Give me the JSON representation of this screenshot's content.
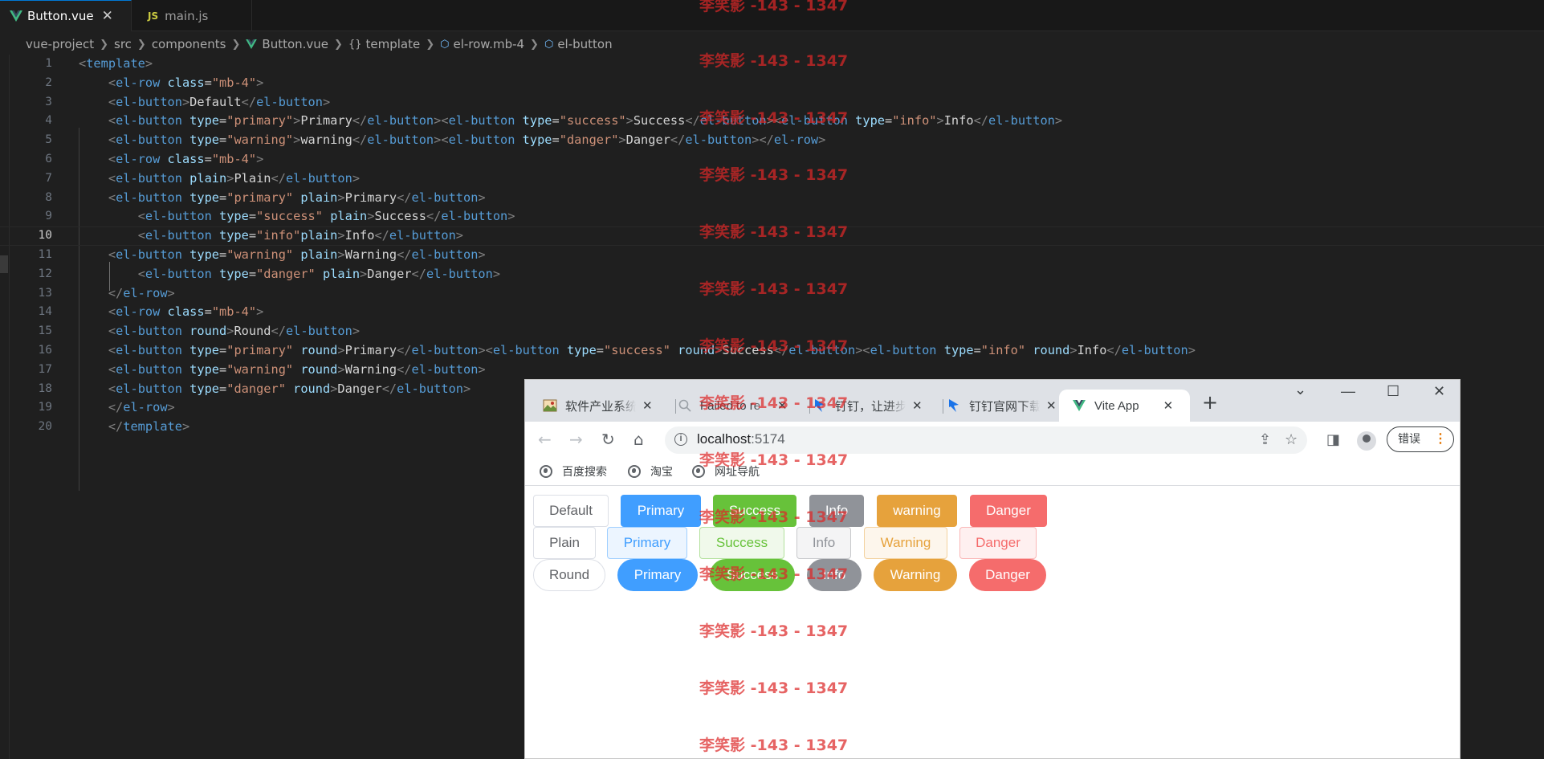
{
  "editor": {
    "tabs": [
      {
        "label": "Button.vue",
        "close": "✕"
      },
      {
        "label": "main.js"
      }
    ],
    "js_badge": "JS",
    "breadcrumb": [
      "vue-project",
      "src",
      "components",
      "Button.vue",
      "template",
      "el-row.mb-4",
      "el-button"
    ],
    "breadcrumb_template_icon": "{}",
    "line_numbers": [
      "1",
      "2",
      "3",
      "4",
      "5",
      "6",
      "7",
      "8",
      "9",
      "10",
      "11",
      "12",
      "13",
      "14",
      "15",
      "16",
      "17",
      "18",
      "19",
      "20"
    ],
    "code_lines": [
      "<template>",
      "    <el-row class=\"mb-4\">",
      "    <el-button>Default</el-button>",
      "    <el-button type=\"primary\">Primary</el-button><el-button type=\"success\">Success</el-button><el-button type=\"info\">Info</el-button>",
      "    <el-button type=\"warning\">warning</el-button><el-button type=\"danger\">Danger</el-button></el-row>",
      "    <el-row class=\"mb-4\">",
      "    <el-button plain>Plain</el-button>",
      "    <el-button type=\"primary\" plain>Primary</el-button>",
      "        <el-button type=\"success\" plain>Success</el-button>",
      "        <el-button type=\"info\"plain>Info</el-button>",
      "    <el-button type=\"warning\" plain>Warning</el-button>",
      "        <el-button type=\"danger\" plain>Danger</el-button>",
      "    </el-row>",
      "    <el-row class=\"mb-4\">",
      "    <el-button round>Round</el-button>",
      "    <el-button type=\"primary\" round>Primary</el-button><el-button type=\"success\" round>Success</el-button><el-button type=\"info\" round>Info</el-button>",
      "    <el-button type=\"warning\" round>Warning</el-button>",
      "    <el-button type=\"danger\" round>Danger</el-button>",
      "    </el-row>",
      "    </template>"
    ],
    "current_line": 10,
    "colors": {
      "tag": "#569cd6",
      "attr": "#9cdcfe",
      "string": "#ce9178",
      "bracket": "#808080",
      "accent": "#0078d4"
    }
  },
  "browser": {
    "tabs": [
      {
        "title": "软件产业系统",
        "icon": "landscape-icon"
      },
      {
        "title": "Failed to re",
        "icon": "search-icon"
      },
      {
        "title": "钉钉，让进步",
        "icon": "dingtalk-icon"
      },
      {
        "title": "钉钉官网下载",
        "icon": "dingtalk-icon"
      },
      {
        "title": "Vite App",
        "icon": "vue-icon",
        "active": true
      }
    ],
    "tab_close": "✕",
    "new_tab": "+",
    "window_controls": {
      "dropdown": "⌄",
      "minimize": "—",
      "maximize": "☐",
      "close": "✕"
    },
    "nav": {
      "back": "←",
      "forward": "→",
      "reload": "↻",
      "home": "⌂"
    },
    "url_host": "localhost",
    "url_port": ":5174",
    "info_glyph": "i",
    "omnibox_actions": {
      "share": "⇪",
      "bookmark": "☆"
    },
    "sidepanel_icon": "◨",
    "error_label": "错误",
    "menu_dots": "⋮",
    "bookmarks": [
      "百度搜索",
      "淘宝",
      "网址导航"
    ],
    "button_rows": [
      [
        {
          "label": "Default",
          "type": "default"
        },
        {
          "label": "Primary",
          "type": "primary"
        },
        {
          "label": "Success",
          "type": "success"
        },
        {
          "label": "Info",
          "type": "info"
        },
        {
          "label": "warning",
          "type": "warning"
        },
        {
          "label": "Danger",
          "type": "danger"
        }
      ],
      [
        {
          "label": "Plain",
          "type": "default"
        },
        {
          "label": "Primary",
          "type": "primary"
        },
        {
          "label": "Success",
          "type": "success"
        },
        {
          "label": "Info",
          "type": "info"
        },
        {
          "label": "Warning",
          "type": "warning"
        },
        {
          "label": "Danger",
          "type": "danger"
        }
      ],
      [
        {
          "label": "Round",
          "type": "default"
        },
        {
          "label": "Primary",
          "type": "primary"
        },
        {
          "label": "Success",
          "type": "success"
        },
        {
          "label": "Info",
          "type": "info"
        },
        {
          "label": "Warning",
          "type": "warning"
        },
        {
          "label": "Danger",
          "type": "danger"
        }
      ]
    ],
    "button_colors": {
      "primary": "#409eff",
      "success": "#67c23a",
      "info": "#909399",
      "warning": "#e6a23c",
      "danger": "#f56c6c"
    }
  },
  "watermark": {
    "text": "李笑影 -143 - 1347",
    "color": "#dc2828"
  }
}
